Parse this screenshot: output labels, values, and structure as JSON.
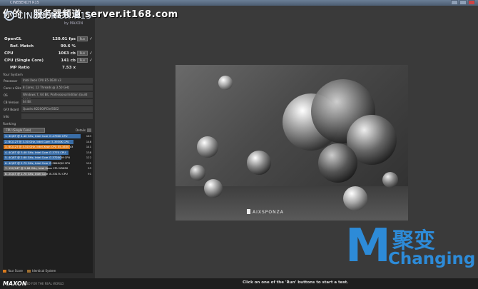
{
  "window": {
    "title": "CINEBENCH R15"
  },
  "watermark": "你的 · 服务器频道 server.it168.com",
  "logo": {
    "name": "CINEBENCH R15",
    "by": "by MAXON"
  },
  "results": [
    {
      "label": "OpenGL",
      "value": "120.01 fps",
      "run": "Run",
      "indent": false
    },
    {
      "label": "Ref. Match",
      "value": "99.6 %",
      "run": "",
      "indent": true
    },
    {
      "label": "CPU",
      "value": "1063 cb",
      "run": "Run",
      "indent": false
    },
    {
      "label": "CPU (Single Core)",
      "value": "141 cb",
      "run": "Run",
      "indent": false
    },
    {
      "label": "MP Ratio",
      "value": "7.53 x",
      "run": "",
      "indent": true
    }
  ],
  "system": {
    "title": "Your System",
    "rows": [
      {
        "k": "Processor",
        "v": "Intel Xeon CPU E5-1630 v3"
      },
      {
        "k": "Cores x GHz",
        "v": "8 Cores, 12 Threads @ 3.50 GHz"
      },
      {
        "k": "OS",
        "v": "Windows 7, 64 Bit, Professional Edition (build 7600)"
      },
      {
        "k": "CB Version",
        "v": "64 Bit"
      },
      {
        "k": "GFX Board",
        "v": "Quadro K2200/PCIe/SSE2"
      },
      {
        "k": "Info",
        "v": ""
      }
    ]
  },
  "ranking": {
    "title": "Ranking",
    "dropdown": "CPU (Single Core)",
    "details": "Details",
    "items": [
      {
        "text": "1. 4C/8T @ 4.40 GHz, Intel Core i7-4790K CPU",
        "score": 163,
        "kind": "other"
      },
      {
        "text": "2. 6C/12T @ 3.30 GHz, Intel Core i7-3930K CPU",
        "score": 148,
        "kind": "other"
      },
      {
        "text": "3. 6C/12T @ 3.50 GHz, Intel Xeon CPU E5-1630 v3",
        "score": 141,
        "kind": "mine"
      },
      {
        "text": "4. 4C/8T @ 3.40 GHz, Intel Core i7-3770 CPU",
        "score": 138,
        "kind": "other"
      },
      {
        "text": "5. 4C/8T @ 2.60 GHz, Intel Core i7-3720QM CPU",
        "score": 122,
        "kind": "other"
      },
      {
        "text": "6. 4C/8T @ 2.79 GHz, Intel Core i7-3840QM CPU",
        "score": 101,
        "kind": "other"
      },
      {
        "text": "7. 12C/24T @ 2.66 GHz, Intel Xeon CPU X5650",
        "score": 93,
        "kind": "gray"
      },
      {
        "text": "8. 2C/4T @ 1.70 GHz, Intel Core i5-3317U CPU",
        "score": 91,
        "kind": "gray"
      }
    ]
  },
  "legend": {
    "your_score": "Your Score",
    "identical": "Identical System",
    "your_color": "#d97a1e",
    "identical_color": "#a07030"
  },
  "footer": {
    "brand": "MAXON",
    "tagline": "3D FOR THE REAL WORLD",
    "status": "Click on one of the 'Run' buttons to start a test."
  },
  "render": {
    "credit": "AIXSPONZA"
  },
  "overlay_logo": {
    "letter": "M",
    "chinese": "聚变",
    "english": "Changing",
    "color": "#2d8bd8"
  }
}
